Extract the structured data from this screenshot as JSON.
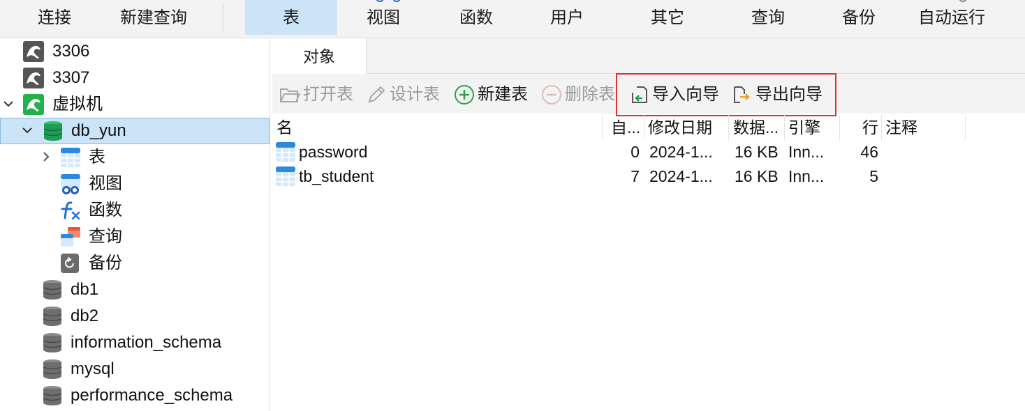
{
  "top_toolbar": {
    "items": [
      "连接",
      "新建查询",
      "表",
      "视图",
      "函数",
      "用户",
      "其它",
      "查询",
      "备份",
      "自动运行"
    ],
    "active_index": 2
  },
  "sidebar": {
    "connections": [
      {
        "label": "3306"
      },
      {
        "label": "3307"
      },
      {
        "label": "虚拟机"
      }
    ],
    "selected_db": "db_yun",
    "db_children": [
      {
        "label": "表"
      },
      {
        "label": "视图"
      },
      {
        "label": "函数"
      },
      {
        "label": "查询"
      },
      {
        "label": "备份"
      }
    ],
    "other_dbs": [
      {
        "label": "db1"
      },
      {
        "label": "db2"
      },
      {
        "label": "information_schema"
      },
      {
        "label": "mysql"
      },
      {
        "label": "performance_schema"
      }
    ]
  },
  "main": {
    "tab_label": "对象",
    "actions": {
      "open_table": "打开表",
      "design_table": "设计表",
      "new_table": "新建表",
      "delete_table": "删除表",
      "import_wizard": "导入向导",
      "export_wizard": "导出向导"
    },
    "table": {
      "columns": [
        "名",
        "自...",
        "修改日期",
        "数据...",
        "引擎",
        "行",
        "注释"
      ],
      "rows": [
        {
          "name": "password",
          "auto": "0",
          "modified": "2024-1...",
          "data": "16 KB",
          "engine": "Inn...",
          "rows": "46",
          "comment": ""
        },
        {
          "name": "tb_student",
          "auto": "7",
          "modified": "2024-1...",
          "data": "16 KB",
          "engine": "Inn...",
          "rows": "5",
          "comment": ""
        }
      ]
    }
  },
  "colors": {
    "active_tab": "#cce4f7",
    "highlight_box": "#e03030",
    "mysql_gray": "#555555",
    "mysql_green": "#22b24c",
    "db_green": "#1f9d55"
  }
}
